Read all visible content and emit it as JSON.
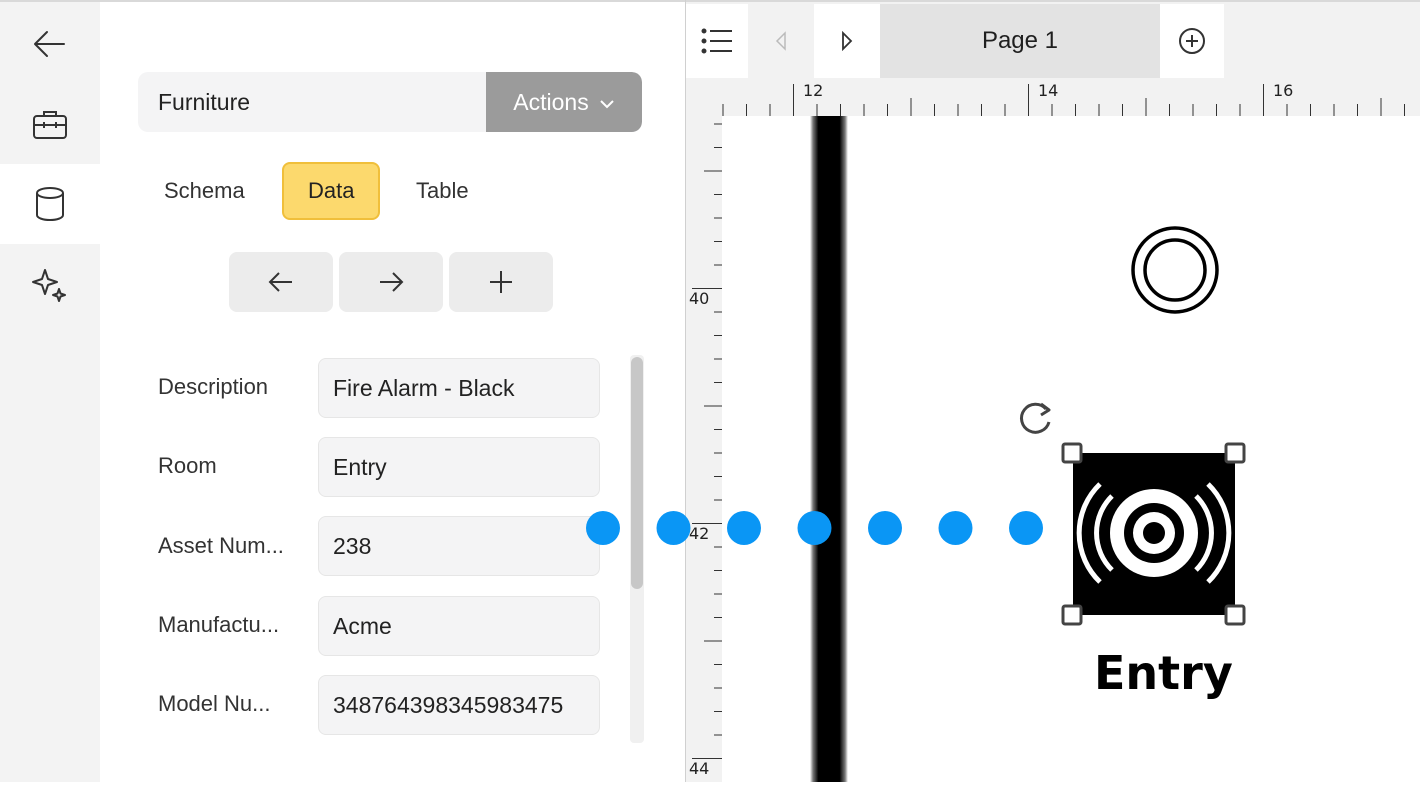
{
  "rail": {
    "items": [
      {
        "name": "back-arrow-icon"
      },
      {
        "name": "toolbox-icon"
      },
      {
        "name": "database-icon",
        "active": true
      },
      {
        "name": "sparkles-icon"
      }
    ]
  },
  "panel": {
    "data_source": "Furniture",
    "actions_label": "Actions",
    "tabs": [
      {
        "label": "Schema"
      },
      {
        "label": "Data",
        "active": true
      },
      {
        "label": "Table"
      }
    ],
    "nav_buttons": [
      "previous-record",
      "next-record",
      "add-record"
    ],
    "fields": [
      {
        "label": "Description",
        "value": "Fire Alarm - Black"
      },
      {
        "label": "Room",
        "value": "Entry"
      },
      {
        "label": "Asset Num...",
        "value": "238"
      },
      {
        "label": "Manufactu...",
        "value": "Acme"
      },
      {
        "label": "Model Nu...",
        "value": "348764398345983475"
      }
    ]
  },
  "toolbar": {
    "page_label": "Page 1"
  },
  "rulers": {
    "top": [
      "12",
      "14",
      "16"
    ],
    "left": [
      "40",
      "42",
      "44"
    ]
  },
  "canvas": {
    "shape_label": "Entry",
    "connector_color": "#0a96f5",
    "accent_yellow": "#fcd96d"
  }
}
